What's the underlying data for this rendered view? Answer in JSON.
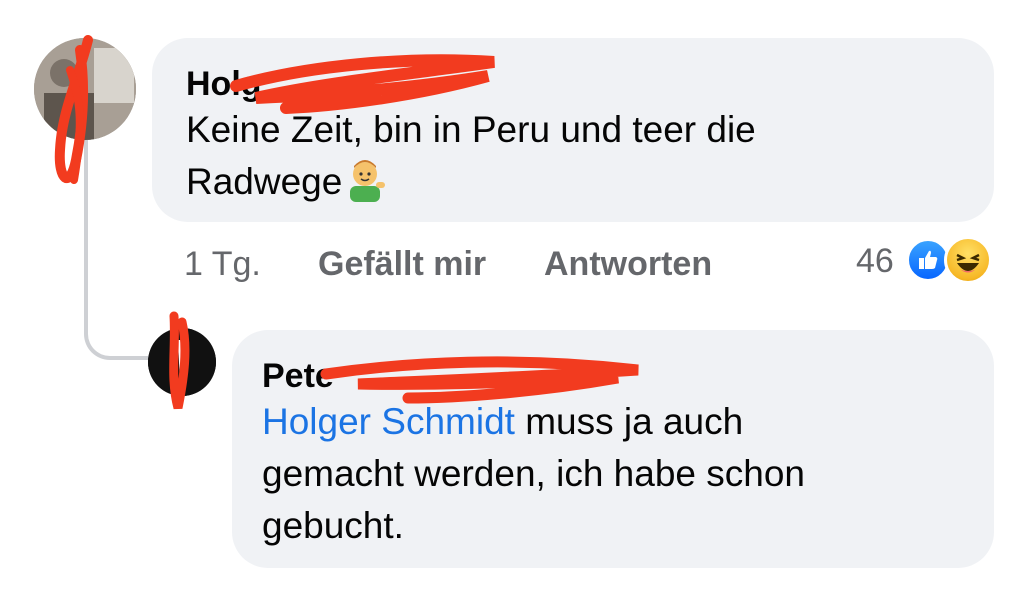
{
  "comment": {
    "author_visible": "Holg",
    "line1": "Keine Zeit, bin in Peru und teer die",
    "line2": "Radwege",
    "emoji": "person-tipping-hand-icon",
    "time": "1 Tg.",
    "like_label": "Gefällt mir",
    "reply_label": "Antworten",
    "reaction_count": "46",
    "reactions": [
      "like-reaction-icon",
      "haha-reaction-icon"
    ]
  },
  "reply": {
    "author_visible": "Pete",
    "mention": "Holger Schmidt",
    "line1_rest": " muss ja auch",
    "line2": "gemacht werden, ich habe schon",
    "line3": "gebucht."
  },
  "colors": {
    "bubble": "#f0f2f5",
    "mention": "#1b74e4",
    "redaction": "#f23b1f",
    "meta": "#65676b"
  }
}
